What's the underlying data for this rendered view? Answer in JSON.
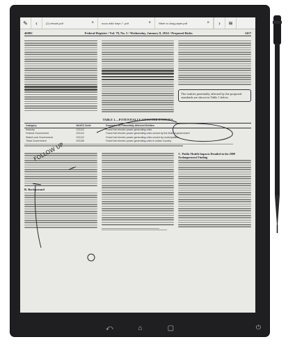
{
  "toolbar": {
    "edit_icon": "pencil-icon",
    "back_icon": "chevron-left-icon",
    "next_icon": "chevron-right-icon",
    "menu_icon": "menu-icon",
    "tabs": [
      {
        "label": "(2) retouls.pdf"
      },
      {
        "label": "nuou wiki/ nayn ? .pdf"
      },
      {
        "label": "Nhiel vu lang paper.pdf"
      }
    ]
  },
  "document": {
    "running_head_left": "46082",
    "running_head_center": "Federal Register / Vol. 79, No. 5 / Wednesday, January 8, 2014 / Proposed Rules",
    "running_head_right": "1437",
    "table_caption": "TABLE 1.—POTENTIALLY AFFECTED ENTITIES",
    "table_headers": [
      "Category",
      "NAICS Code",
      "Examples of Potentially Affected Entities"
    ],
    "table_rows": [
      [
        "Industry",
        "221112",
        "Fossil fuel electric power generating units"
      ],
      [
        "Federal Government",
        "221112",
        "Fossil fuel electric power generating units owned by the federal government"
      ],
      [
        "State/Local Government",
        "221112",
        "Fossil fuel electric power generating units owned by municipalities"
      ],
      [
        "Tribal Government",
        "921150",
        "Fossil fuel electric power generating units in Indian Country"
      ]
    ],
    "box_text": "The entities potentially affected by the proposed standards are shown in Table 1 below.",
    "section_head_b": "B. Background",
    "section_head_c": "C. Public Health Impacts Detailed in the 2009 Endangerment Finding"
  },
  "annotations": {
    "margin_note": "FOLLOW UP"
  },
  "nav": {
    "back_icon": "back-icon",
    "home_icon": "home-icon",
    "recent_icon": "square-icon",
    "power_icon": "power-icon"
  }
}
